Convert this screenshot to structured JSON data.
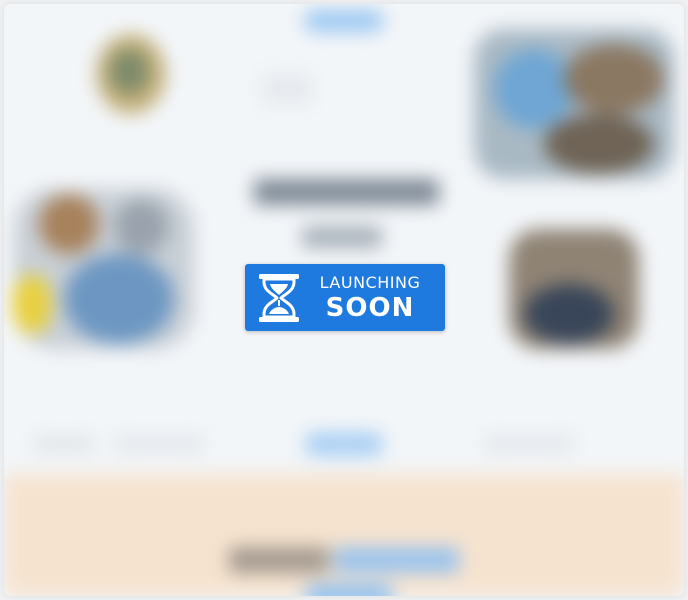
{
  "badge": {
    "line1": "LAUNCHING",
    "line2": "SOON",
    "icon": "hourglass-icon",
    "background": "#1f7ae0",
    "text_color": "#ffffff"
  }
}
